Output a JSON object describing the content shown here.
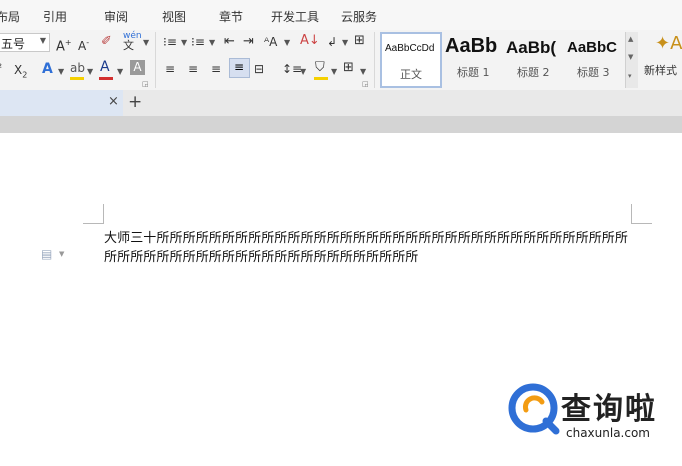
{
  "menu": {
    "tabs": [
      "布局",
      "引用",
      "审阅",
      "视图",
      "章节",
      "开发工具",
      "云服务"
    ]
  },
  "ribbon": {
    "font_size_value": "五号",
    "styles": [
      {
        "preview": "AaBbCcDd",
        "label": "正文"
      },
      {
        "preview": "AaBb",
        "label": "标题 1"
      },
      {
        "preview": "AaBb(",
        "label": "标题 2"
      },
      {
        "preview": "AaBbC",
        "label": "标题 3"
      }
    ],
    "new_style_label": "新样式"
  },
  "doc_tabs": {
    "close_glyph": "×",
    "add_glyph": "+"
  },
  "document": {
    "lines": [
      "大师三十所所所所所所所所所所所所所所所所所所所所所所所所所所所所所所所所所所所所",
      "所所所所所所所所所所所所所所所所所所所所所所所所"
    ]
  },
  "watermark": {
    "title": "查询啦",
    "url": "chaxunla.com"
  },
  "colors": {
    "accent_blue": "#2f6fd6",
    "font_color_red": "#d32f2f",
    "highlight_yellow": "#f5d000",
    "watermark_orange": "#f39c12"
  }
}
